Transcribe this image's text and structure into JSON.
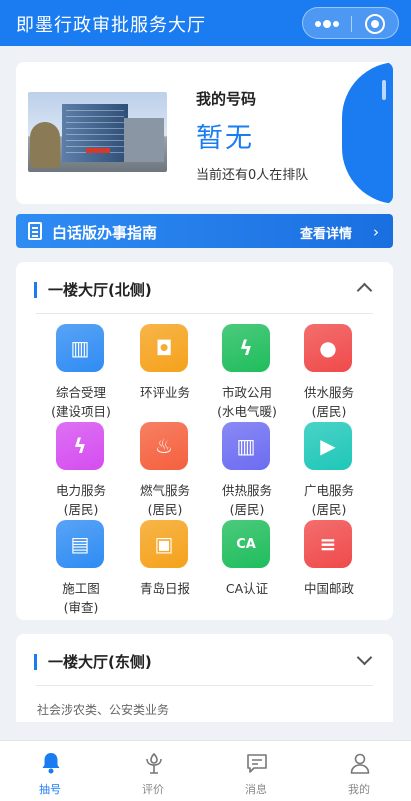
{
  "header": {
    "title": "即墨行政审批服务大厅"
  },
  "queue": {
    "label": "我的号码",
    "number": "暂无",
    "status": "当前还有0人在排队"
  },
  "guide": {
    "text": "白话版办事指南",
    "more": "查看详情"
  },
  "halls": [
    {
      "title": "一楼大厅(北侧)",
      "expanded": true,
      "services": [
        {
          "name": "综合受理(建设项目)",
          "icon": "building-icon",
          "color": "#2f8cf3",
          "glyph": "▥"
        },
        {
          "name": "环评业务",
          "icon": "certificate-icon",
          "color": "#f5a21b",
          "glyph": "◘"
        },
        {
          "name": "市政公用(水电气暖)",
          "icon": "utility-icon",
          "color": "#1fbd5c",
          "glyph": "ϟ"
        },
        {
          "name": "供水服务(居民)",
          "icon": "water-drop-icon",
          "color": "#f04a4a",
          "glyph": "●"
        },
        {
          "name": "电力服务(居民)",
          "icon": "lightning-icon",
          "color": "#d54df0",
          "glyph": "ϟ"
        },
        {
          "name": "燃气服务(居民)",
          "icon": "flame-icon",
          "color": "#f5603d",
          "glyph": "♨"
        },
        {
          "name": "供热服务(居民)",
          "icon": "radiator-icon",
          "color": "#6c6cf2",
          "glyph": "▥"
        },
        {
          "name": "广电服务(居民)",
          "icon": "tv-icon",
          "color": "#1ec7b8",
          "glyph": "▶"
        },
        {
          "name": "施工图(审查)",
          "icon": "clipboard-icon",
          "color": "#2f8cf3",
          "glyph": "▤"
        },
        {
          "name": "青岛日报",
          "icon": "newspaper-icon",
          "color": "#f5a21b",
          "glyph": "▣"
        },
        {
          "name": "CA认证",
          "icon": "ca-badge-icon",
          "color": "#1fbd5c",
          "glyph": "CA"
        },
        {
          "name": "中国邮政",
          "icon": "post-office-icon",
          "color": "#f04a4a",
          "glyph": "≡"
        }
      ]
    },
    {
      "title": "一楼大厅(东侧)",
      "expanded": false,
      "subtitle": "社会涉农类、公安类业务"
    }
  ],
  "tabs": [
    {
      "label": "抽号",
      "icon": "bell-icon",
      "active": true
    },
    {
      "label": "评价",
      "icon": "flower-icon",
      "active": false
    },
    {
      "label": "消息",
      "icon": "message-icon",
      "active": false
    },
    {
      "label": "我的",
      "icon": "user-icon",
      "active": false
    }
  ],
  "colors": {
    "primary": "#1a7cf0"
  }
}
